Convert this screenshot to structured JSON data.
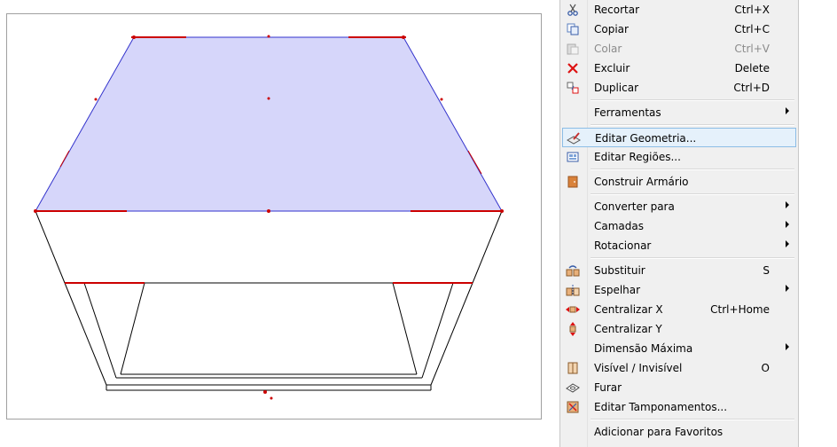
{
  "menu": {
    "items": [
      {
        "label": "Recortar",
        "shortcut": "Ctrl+X",
        "icon": "scissors-icon",
        "enabled": true,
        "submenu": false
      },
      {
        "label": "Copiar",
        "shortcut": "Ctrl+C",
        "icon": "copy-icon",
        "enabled": true,
        "submenu": false
      },
      {
        "label": "Colar",
        "shortcut": "Ctrl+V",
        "icon": "paste-icon",
        "enabled": false,
        "submenu": false
      },
      {
        "label": "Excluir",
        "shortcut": "Delete",
        "icon": "delete-x-icon",
        "enabled": true,
        "submenu": false
      },
      {
        "label": "Duplicar",
        "shortcut": "Ctrl+D",
        "icon": "duplicate-icon",
        "enabled": true,
        "submenu": false
      },
      {
        "label": "Ferramentas",
        "shortcut": "",
        "icon": "",
        "enabled": true,
        "submenu": true
      },
      {
        "label": "Editar Geometria...",
        "shortcut": "",
        "icon": "edit-geometry-icon",
        "enabled": true,
        "submenu": false,
        "highlighted": true
      },
      {
        "label": "Editar Regiões...",
        "shortcut": "",
        "icon": "edit-regions-icon",
        "enabled": true,
        "submenu": false
      },
      {
        "label": "Construir Armário",
        "shortcut": "",
        "icon": "cabinet-icon",
        "enabled": true,
        "submenu": false
      },
      {
        "label": "Converter para",
        "shortcut": "",
        "icon": "",
        "enabled": true,
        "submenu": true
      },
      {
        "label": "Camadas",
        "shortcut": "",
        "icon": "",
        "enabled": true,
        "submenu": true
      },
      {
        "label": "Rotacionar",
        "shortcut": "",
        "icon": "",
        "enabled": true,
        "submenu": true
      },
      {
        "label": "Substituir",
        "shortcut": "S",
        "icon": "replace-icon",
        "enabled": true,
        "submenu": false
      },
      {
        "label": "Espelhar",
        "shortcut": "",
        "icon": "mirror-icon",
        "enabled": true,
        "submenu": true
      },
      {
        "label": "Centralizar X",
        "shortcut": "Ctrl+Home",
        "icon": "center-x-icon",
        "enabled": true,
        "submenu": false
      },
      {
        "label": "Centralizar Y",
        "shortcut": "",
        "icon": "center-y-icon",
        "enabled": true,
        "submenu": false
      },
      {
        "label": "Dimensão Máxima",
        "shortcut": "",
        "icon": "",
        "enabled": true,
        "submenu": true
      },
      {
        "label": "Visível / Invisível",
        "shortcut": "O",
        "icon": "visibility-icon",
        "enabled": true,
        "submenu": false
      },
      {
        "label": "Furar",
        "shortcut": "",
        "icon": "drill-icon",
        "enabled": true,
        "submenu": false
      },
      {
        "label": "Editar Tamponamentos...",
        "shortcut": "",
        "icon": "edit-cover-icon",
        "enabled": true,
        "submenu": false
      },
      {
        "label": "Adicionar para Favoritos",
        "shortcut": "",
        "icon": "",
        "enabled": true,
        "submenu": false
      }
    ]
  },
  "colors": {
    "selection_fill": "#d6d6fa",
    "selection_edge": "#3333cc",
    "highlight_edge": "#dd0000",
    "menu_highlight": "#e5f1fb"
  }
}
